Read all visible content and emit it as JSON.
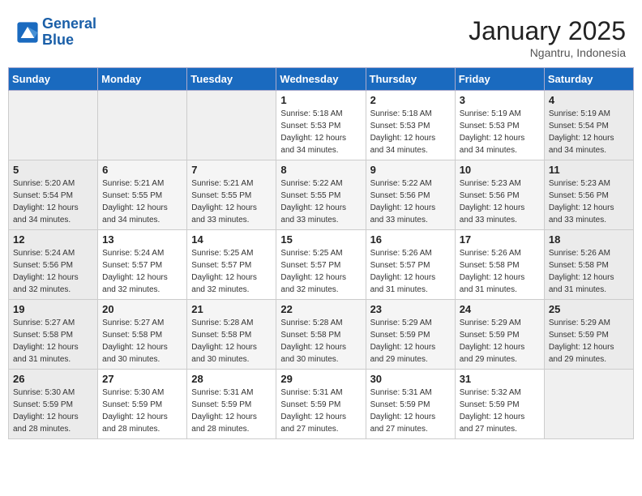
{
  "header": {
    "logo_general": "General",
    "logo_blue": "Blue",
    "month_year": "January 2025",
    "location": "Ngantru, Indonesia"
  },
  "days_of_week": [
    "Sunday",
    "Monday",
    "Tuesday",
    "Wednesday",
    "Thursday",
    "Friday",
    "Saturday"
  ],
  "weeks": [
    [
      {
        "day": "",
        "info": ""
      },
      {
        "day": "",
        "info": ""
      },
      {
        "day": "",
        "info": ""
      },
      {
        "day": "1",
        "info": "Sunrise: 5:18 AM\nSunset: 5:53 PM\nDaylight: 12 hours\nand 34 minutes."
      },
      {
        "day": "2",
        "info": "Sunrise: 5:18 AM\nSunset: 5:53 PM\nDaylight: 12 hours\nand 34 minutes."
      },
      {
        "day": "3",
        "info": "Sunrise: 5:19 AM\nSunset: 5:53 PM\nDaylight: 12 hours\nand 34 minutes."
      },
      {
        "day": "4",
        "info": "Sunrise: 5:19 AM\nSunset: 5:54 PM\nDaylight: 12 hours\nand 34 minutes."
      }
    ],
    [
      {
        "day": "5",
        "info": "Sunrise: 5:20 AM\nSunset: 5:54 PM\nDaylight: 12 hours\nand 34 minutes."
      },
      {
        "day": "6",
        "info": "Sunrise: 5:21 AM\nSunset: 5:55 PM\nDaylight: 12 hours\nand 34 minutes."
      },
      {
        "day": "7",
        "info": "Sunrise: 5:21 AM\nSunset: 5:55 PM\nDaylight: 12 hours\nand 33 minutes."
      },
      {
        "day": "8",
        "info": "Sunrise: 5:22 AM\nSunset: 5:55 PM\nDaylight: 12 hours\nand 33 minutes."
      },
      {
        "day": "9",
        "info": "Sunrise: 5:22 AM\nSunset: 5:56 PM\nDaylight: 12 hours\nand 33 minutes."
      },
      {
        "day": "10",
        "info": "Sunrise: 5:23 AM\nSunset: 5:56 PM\nDaylight: 12 hours\nand 33 minutes."
      },
      {
        "day": "11",
        "info": "Sunrise: 5:23 AM\nSunset: 5:56 PM\nDaylight: 12 hours\nand 33 minutes."
      }
    ],
    [
      {
        "day": "12",
        "info": "Sunrise: 5:24 AM\nSunset: 5:56 PM\nDaylight: 12 hours\nand 32 minutes."
      },
      {
        "day": "13",
        "info": "Sunrise: 5:24 AM\nSunset: 5:57 PM\nDaylight: 12 hours\nand 32 minutes."
      },
      {
        "day": "14",
        "info": "Sunrise: 5:25 AM\nSunset: 5:57 PM\nDaylight: 12 hours\nand 32 minutes."
      },
      {
        "day": "15",
        "info": "Sunrise: 5:25 AM\nSunset: 5:57 PM\nDaylight: 12 hours\nand 32 minutes."
      },
      {
        "day": "16",
        "info": "Sunrise: 5:26 AM\nSunset: 5:57 PM\nDaylight: 12 hours\nand 31 minutes."
      },
      {
        "day": "17",
        "info": "Sunrise: 5:26 AM\nSunset: 5:58 PM\nDaylight: 12 hours\nand 31 minutes."
      },
      {
        "day": "18",
        "info": "Sunrise: 5:26 AM\nSunset: 5:58 PM\nDaylight: 12 hours\nand 31 minutes."
      }
    ],
    [
      {
        "day": "19",
        "info": "Sunrise: 5:27 AM\nSunset: 5:58 PM\nDaylight: 12 hours\nand 31 minutes."
      },
      {
        "day": "20",
        "info": "Sunrise: 5:27 AM\nSunset: 5:58 PM\nDaylight: 12 hours\nand 30 minutes."
      },
      {
        "day": "21",
        "info": "Sunrise: 5:28 AM\nSunset: 5:58 PM\nDaylight: 12 hours\nand 30 minutes."
      },
      {
        "day": "22",
        "info": "Sunrise: 5:28 AM\nSunset: 5:58 PM\nDaylight: 12 hours\nand 30 minutes."
      },
      {
        "day": "23",
        "info": "Sunrise: 5:29 AM\nSunset: 5:59 PM\nDaylight: 12 hours\nand 29 minutes."
      },
      {
        "day": "24",
        "info": "Sunrise: 5:29 AM\nSunset: 5:59 PM\nDaylight: 12 hours\nand 29 minutes."
      },
      {
        "day": "25",
        "info": "Sunrise: 5:29 AM\nSunset: 5:59 PM\nDaylight: 12 hours\nand 29 minutes."
      }
    ],
    [
      {
        "day": "26",
        "info": "Sunrise: 5:30 AM\nSunset: 5:59 PM\nDaylight: 12 hours\nand 28 minutes."
      },
      {
        "day": "27",
        "info": "Sunrise: 5:30 AM\nSunset: 5:59 PM\nDaylight: 12 hours\nand 28 minutes."
      },
      {
        "day": "28",
        "info": "Sunrise: 5:31 AM\nSunset: 5:59 PM\nDaylight: 12 hours\nand 28 minutes."
      },
      {
        "day": "29",
        "info": "Sunrise: 5:31 AM\nSunset: 5:59 PM\nDaylight: 12 hours\nand 27 minutes."
      },
      {
        "day": "30",
        "info": "Sunrise: 5:31 AM\nSunset: 5:59 PM\nDaylight: 12 hours\nand 27 minutes."
      },
      {
        "day": "31",
        "info": "Sunrise: 5:32 AM\nSunset: 5:59 PM\nDaylight: 12 hours\nand 27 minutes."
      },
      {
        "day": "",
        "info": ""
      }
    ]
  ]
}
